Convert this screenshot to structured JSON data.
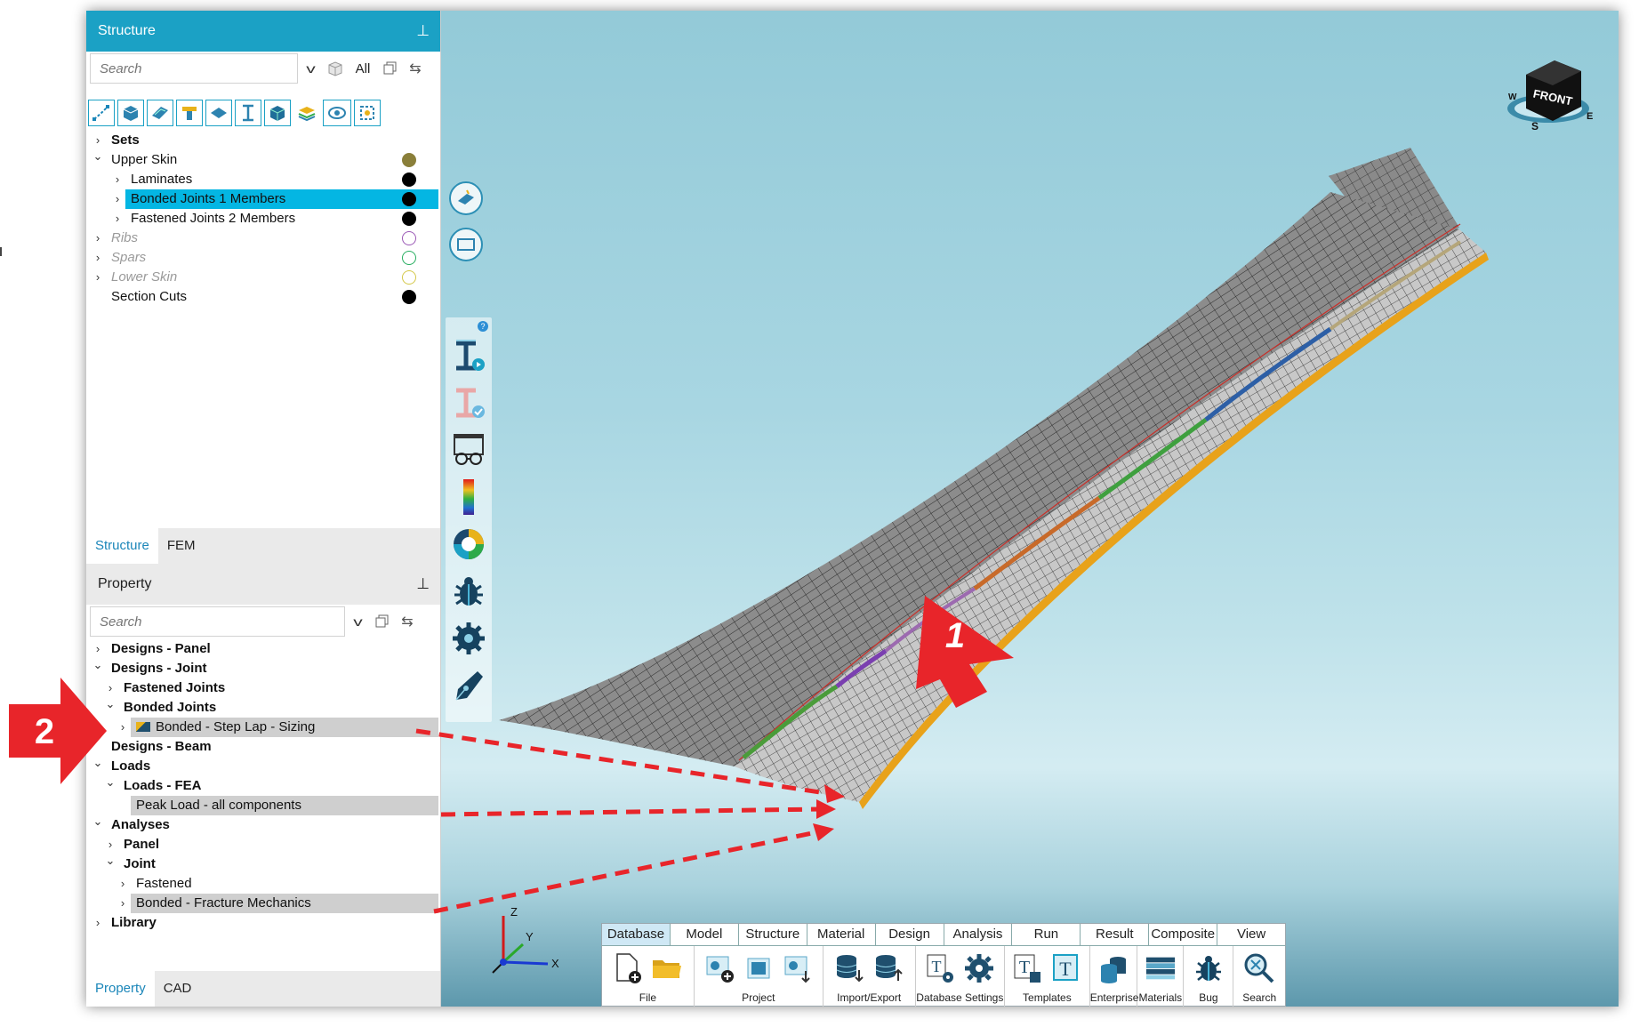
{
  "structure_pane": {
    "title": "Structure",
    "search_placeholder": "Search",
    "filter_all": "All",
    "tree": [
      {
        "label": "Sets",
        "level": 0,
        "expander": "›",
        "style": "bold"
      },
      {
        "label": "Upper Skin",
        "level": 0,
        "expander": "⌄",
        "dot": "#8a7f3a",
        "dot_filled": true
      },
      {
        "label": "Laminates",
        "level": 1,
        "expander": "›",
        "dot": "#000000",
        "dot_filled": true
      },
      {
        "label": "Bonded Joints 1 Members",
        "level": 1,
        "expander": "›",
        "dot": "#000000",
        "dot_filled": true,
        "selected": true
      },
      {
        "label": "Fastened Joints 2 Members",
        "level": 1,
        "expander": "›",
        "dot": "#000000",
        "dot_filled": true
      },
      {
        "label": "Ribs",
        "level": 0,
        "expander": "›",
        "dot": "#9b59b6",
        "dot_filled": false,
        "style": "dim"
      },
      {
        "label": "Spars",
        "level": 0,
        "expander": "›",
        "dot": "#27ae60",
        "dot_filled": false,
        "style": "dim"
      },
      {
        "label": "Lower Skin",
        "level": 0,
        "expander": "›",
        "dot": "#d4c84a",
        "dot_filled": false,
        "style": "dim"
      },
      {
        "label": "Section Cuts",
        "level": 0,
        "expander": "",
        "dot": "#000000",
        "dot_filled": true
      }
    ],
    "tabs": [
      "Structure",
      "FEM"
    ]
  },
  "property_pane": {
    "title": "Property",
    "search_placeholder": "Search",
    "tree": [
      {
        "label": "Designs - Panel",
        "level": 0,
        "expander": "›",
        "style": "bold"
      },
      {
        "label": "Designs - Joint",
        "level": 0,
        "expander": "⌄",
        "style": "bold"
      },
      {
        "label": "Fastened Joints",
        "level": 1,
        "expander": "›",
        "style": "bold"
      },
      {
        "label": "Bonded Joints",
        "level": 1,
        "expander": "⌄",
        "style": "bold"
      },
      {
        "label": "Bonded - Step Lap - Sizing",
        "level": 2,
        "expander": "›",
        "highlight": true,
        "icon": true
      },
      {
        "label": "Designs - Beam",
        "level": 0,
        "expander": "",
        "style": "bold"
      },
      {
        "label": "Loads",
        "level": 0,
        "expander": "⌄",
        "style": "bold"
      },
      {
        "label": "Loads - FEA",
        "level": 1,
        "expander": "⌄",
        "style": "bold"
      },
      {
        "label": "Peak Load - all components",
        "level": 2,
        "expander": "",
        "highlight": true
      },
      {
        "label": "Analyses",
        "level": 0,
        "expander": "⌄",
        "style": "bold"
      },
      {
        "label": "Panel",
        "level": 1,
        "expander": "›",
        "style": "bold"
      },
      {
        "label": "Joint",
        "level": 1,
        "expander": "⌄",
        "style": "bold"
      },
      {
        "label": "Fastened",
        "level": 2,
        "expander": "›"
      },
      {
        "label": "Bonded - Fracture Mechanics",
        "level": 2,
        "expander": "›",
        "highlight": true
      },
      {
        "label": "Library",
        "level": 0,
        "expander": "›",
        "style": "bold"
      }
    ],
    "tabs": [
      "Property",
      "CAD"
    ]
  },
  "viewport": {
    "view_cube_label": "FRONT",
    "compass": {
      "w": "W",
      "s": "S",
      "e": "E"
    },
    "axes": {
      "x": "X",
      "y": "Y",
      "z": "Z"
    }
  },
  "annotations": {
    "arrow_1": "1",
    "arrow_2": "2",
    "color": "#e8252a"
  },
  "ribbon": {
    "tabs": [
      "Database",
      "Model",
      "Structure",
      "Material",
      "Design",
      "Analysis",
      "Run",
      "Result",
      "Composite",
      "View"
    ],
    "active_tab": "Database",
    "groups": [
      "File",
      "Project",
      "Import/Export",
      "Database Settings",
      "Templates",
      "Enterprise",
      "Materials",
      "Bug",
      "Search"
    ]
  },
  "colors": {
    "accent": "#1ba1c5",
    "selection": "#04b6e3",
    "highlight": "#cfcfcf",
    "joint_orange": "#e8a21a"
  }
}
